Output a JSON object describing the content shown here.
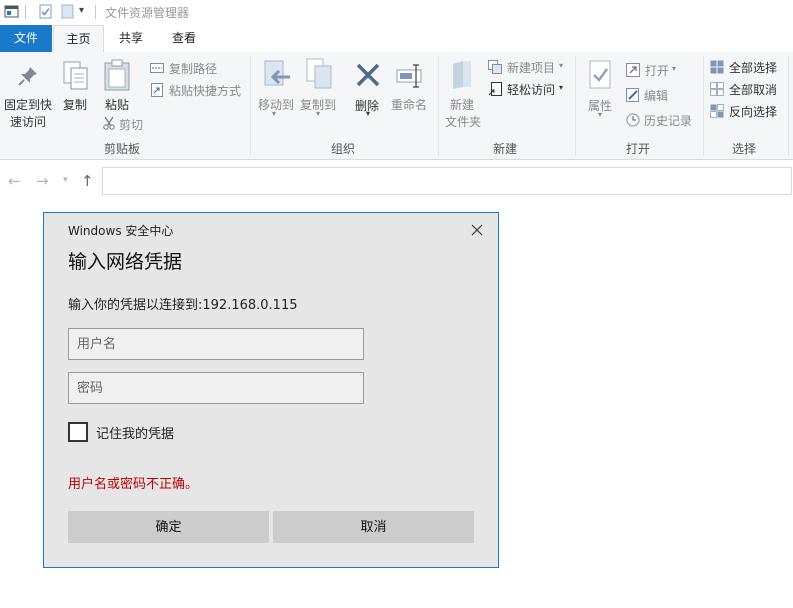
{
  "window": {
    "title": "文件资源管理器"
  },
  "tabs": [
    {
      "label": "文件"
    },
    {
      "label": "主页"
    },
    {
      "label": "共享"
    },
    {
      "label": "查看"
    }
  ],
  "ribbon": {
    "clipboard": {
      "label": "剪贴板",
      "pin_line1": "固定到快",
      "pin_line2": "速访问",
      "copy": "复制",
      "paste": "粘贴",
      "copy_path": "复制路径",
      "paste_shortcut": "粘贴快捷方式",
      "cut": "剪切"
    },
    "organize": {
      "label": "组织",
      "move_to": "移动到",
      "copy_to": "复制到",
      "delete": "删除",
      "rename": "重命名"
    },
    "new": {
      "label": "新建",
      "new_folder_line1": "新建",
      "new_folder_line2": "文件夹",
      "new_item": "新建项目",
      "easy_access": "轻松访问"
    },
    "open": {
      "label": "打开",
      "properties": "属性",
      "open": "打开",
      "edit": "编辑",
      "history": "历史记录"
    },
    "select": {
      "label": "选择",
      "select_all": "全部选择",
      "select_none": "全部取消",
      "invert": "反向选择"
    }
  },
  "dialog": {
    "app_name": "Windows 安全中心",
    "title": "输入网络凭据",
    "message": "输入你的凭据以连接到:192.168.0.115",
    "username_placeholder": "用户名",
    "password_placeholder": "密码",
    "remember_label": "记住我的凭据",
    "remember_checked": false,
    "error": "用户名或密码不正确。",
    "ok": "确定",
    "cancel": "取消"
  },
  "colors": {
    "accent": "#1979ca",
    "error": "#c00000",
    "ribbon_bg": "#f5f6f7",
    "dialog_bg": "#e6e6e6"
  }
}
